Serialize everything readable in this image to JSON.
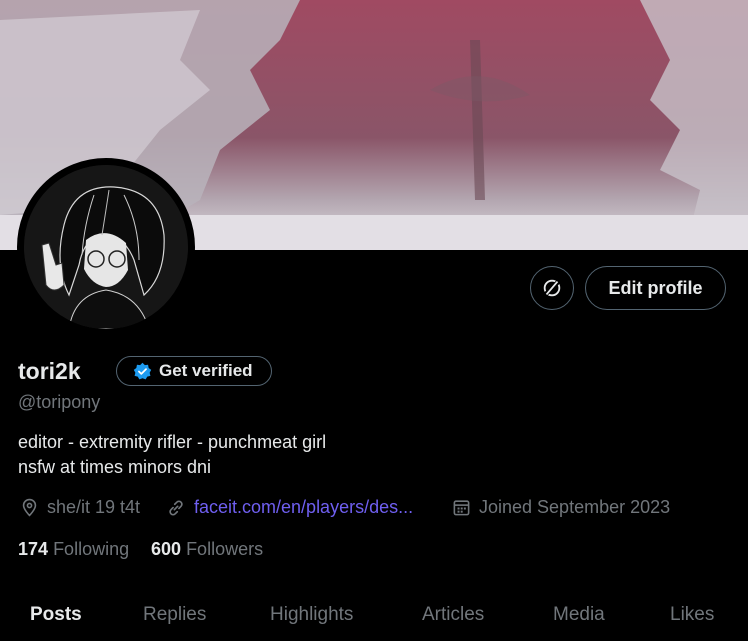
{
  "profile": {
    "display_name": "tori2k",
    "handle": "@toripony",
    "verify_label": "Get verified",
    "edit_label": "Edit profile",
    "bio": [
      "editor - extremity rifler - punchmeat girl",
      "nsfw at times minors dni"
    ],
    "location": "she/it 19 t4t",
    "website": "faceit.com/en/players/des...",
    "joined": "Joined September 2023",
    "following_count": "174",
    "following_label": "Following",
    "followers_count": "600",
    "followers_label": "Followers"
  },
  "tabs": [
    "Posts",
    "Replies",
    "Highlights",
    "Articles",
    "Media",
    "Likes"
  ],
  "active_tab": "Posts",
  "colors": {
    "background": "#000000",
    "text": "#e7e9ea",
    "muted": "#71767b",
    "border": "#536471",
    "link": "#6f5ff0",
    "verified": "#1d9bf0"
  },
  "icons": [
    "sync-icon",
    "verified-badge-icon",
    "location-icon",
    "link-icon",
    "calendar-icon"
  ]
}
